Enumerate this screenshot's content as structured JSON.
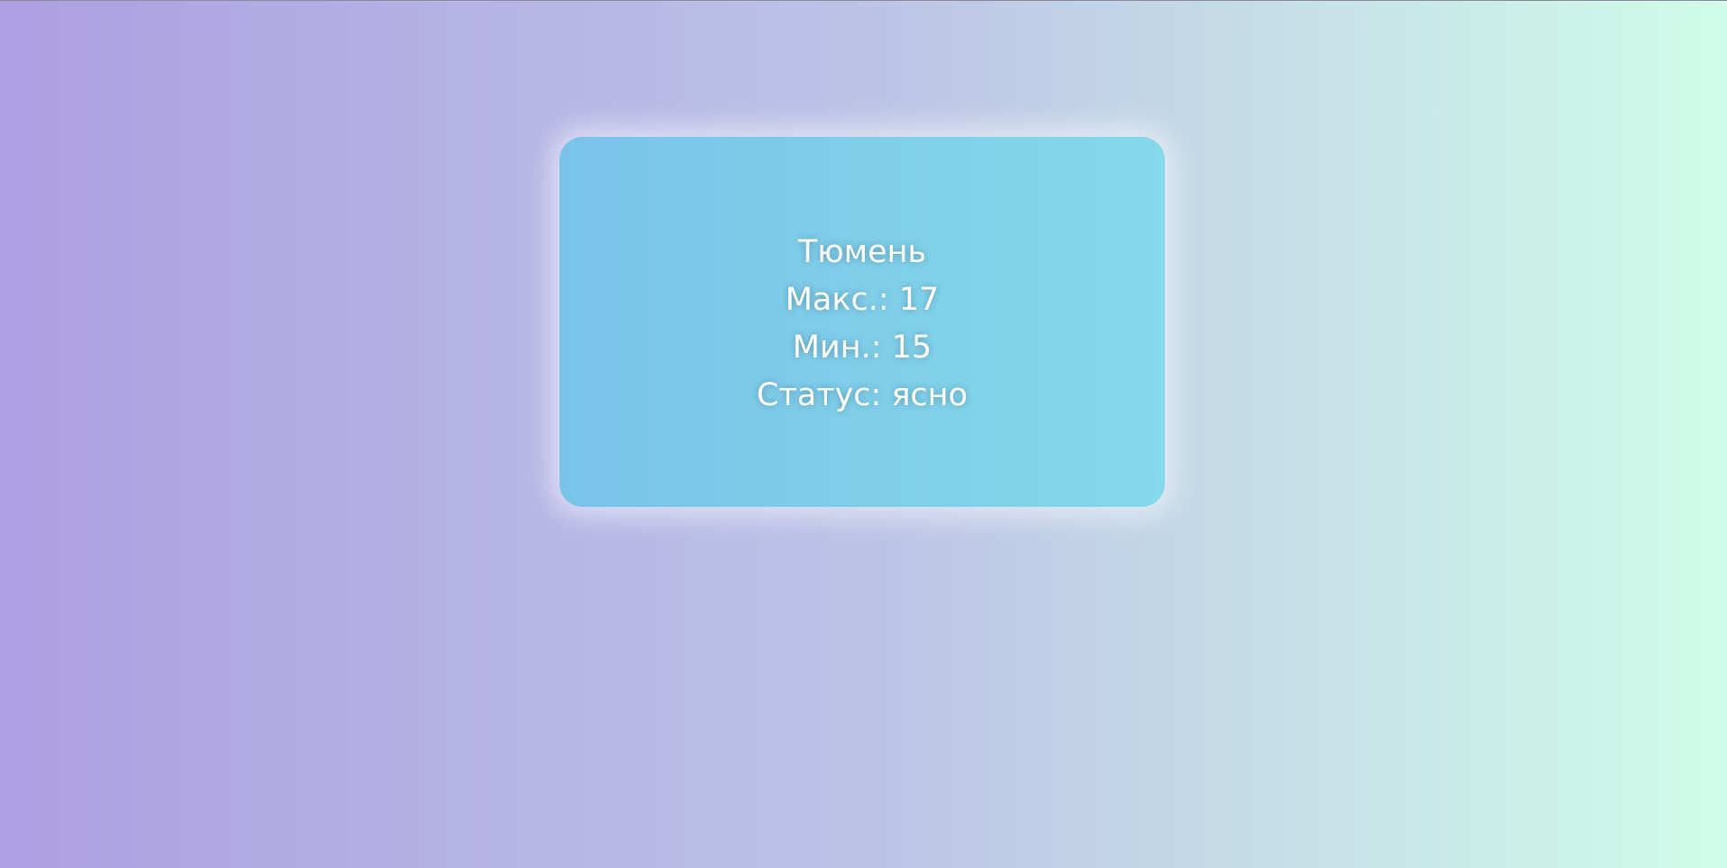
{
  "weather": {
    "city": "Тюмень",
    "max": "Макс.: 17",
    "min": "Мин.: 15",
    "status": "Статус: ясно"
  },
  "colors": {
    "background_left": "#ad9fe2",
    "background_middle": "#bcc3e6",
    "background_right": "#d0fce9",
    "card_left": "#79c3e9",
    "card_right": "#84d9eb",
    "text": "#ffffff"
  }
}
